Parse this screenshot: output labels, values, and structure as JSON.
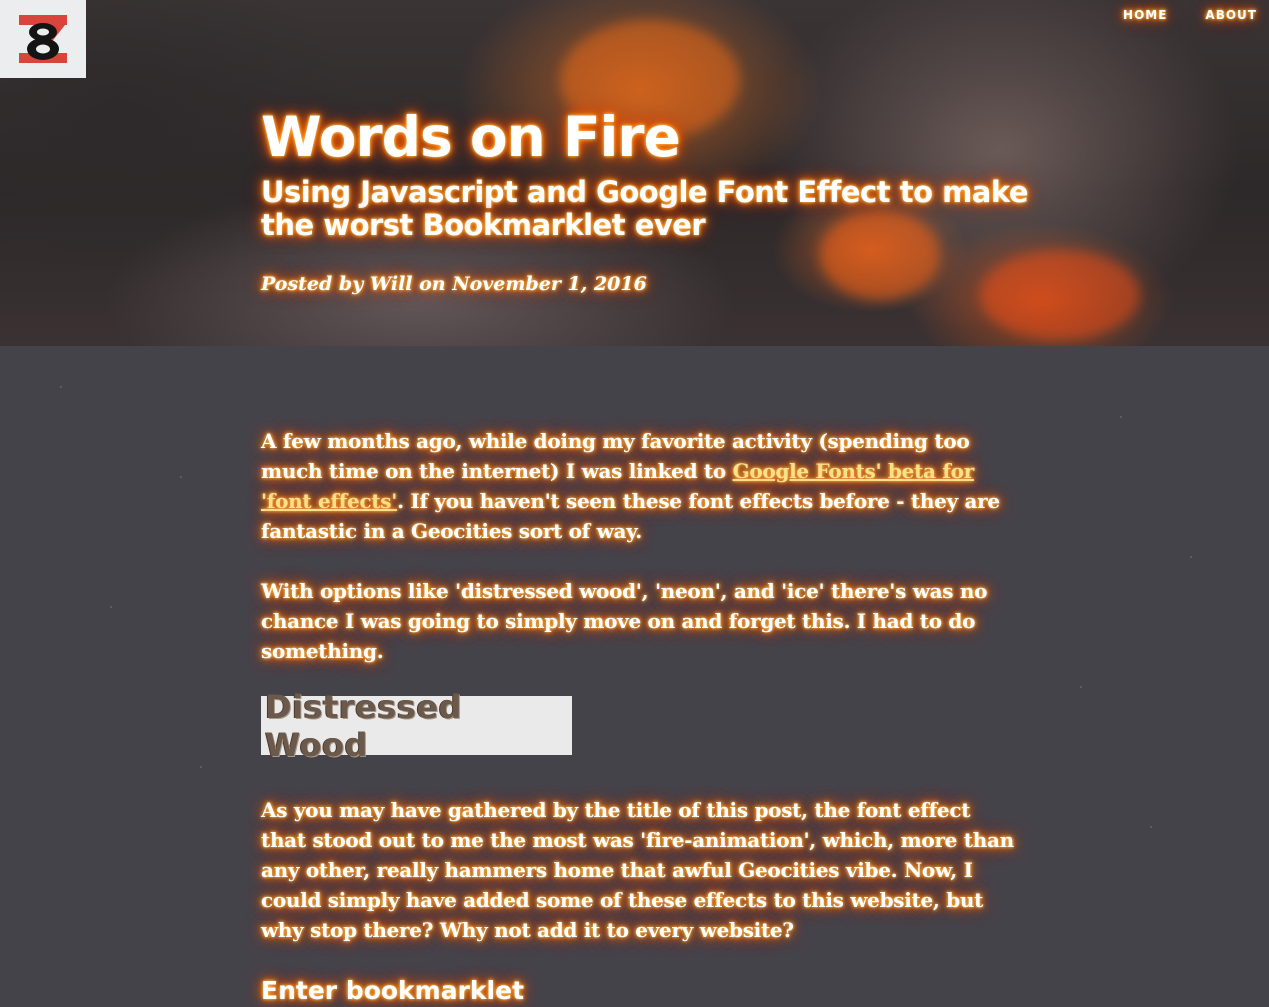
{
  "nav": {
    "home": "HOME",
    "about": "ABOUT"
  },
  "post": {
    "title": "Words on Fire",
    "subtitle": "Using Javascript and Google Font Effect to make the worst Bookmarklet ever",
    "meta": "Posted by Will on November 1, 2016"
  },
  "body": {
    "p1_before": "A few months ago, while doing my favorite activity (spending too much time on the internet) I was linked to ",
    "p1_link": "Google Fonts' beta for 'font effects'",
    "p1_middle": ". If you haven't seen these font effects before - ",
    "p1_strong": "they are fantastic",
    "p1_after": " in a Geocities sort of way.",
    "p2": "With options like 'distressed wood', 'neon', and 'ice' there's was no chance I was going to simply move on and forget this. I had to do something.",
    "demo_text": "Distressed Wood",
    "p3": "As you may have gathered by the title of this post, the font effect that stood out to me the most was 'fire-animation', which, more than any other, really hammers home that awful Geocities vibe. Now, I could simply have added some of these effects to this website, but why stop there? Why not add it to every website?",
    "section_heading": "Enter bookmarklet"
  },
  "colors": {
    "glow": "#ff6a00",
    "hero_dark": "#2d2829",
    "page_bg": "#45434a",
    "logo_red": "#d9453a"
  }
}
